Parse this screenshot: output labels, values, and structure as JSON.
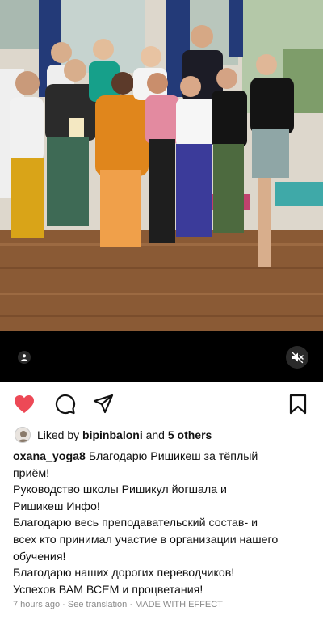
{
  "post": {
    "media": {
      "type": "video",
      "muted": true
    },
    "liked_by": {
      "prefix": "Liked by",
      "user": "bipinbaloni",
      "conj": "and",
      "others": "5 others"
    },
    "caption": {
      "username": "oxana_yoga8",
      "first_line": "Благодарю Ришикеш за тёплый",
      "lines": [
        "приём!",
        "Руководство школы Ришикул йогшала и",
        "Ришикеш Инфо!",
        "Благодарю весь преподавательский состав- и",
        "всех кто принимал участие в организации нашего",
        "обучения!",
        "Благодарю наших дорогих переводчиков!",
        "Успехов ВАМ ВСЕМ и процветания!"
      ]
    },
    "meta": {
      "time": "7 hours ago",
      "sep": "·",
      "translate": "See translation",
      "effect": "MADE WITH EFFECT"
    }
  },
  "icons": {
    "like": "heart-filled-icon",
    "comment": "comment-icon",
    "share": "paper-plane-icon",
    "save": "bookmark-icon",
    "tag": "person-tag-icon",
    "mute": "speaker-muted-icon"
  },
  "colors": {
    "like": "#ed4956",
    "text": "#111111",
    "meta": "#8a8a8a"
  }
}
